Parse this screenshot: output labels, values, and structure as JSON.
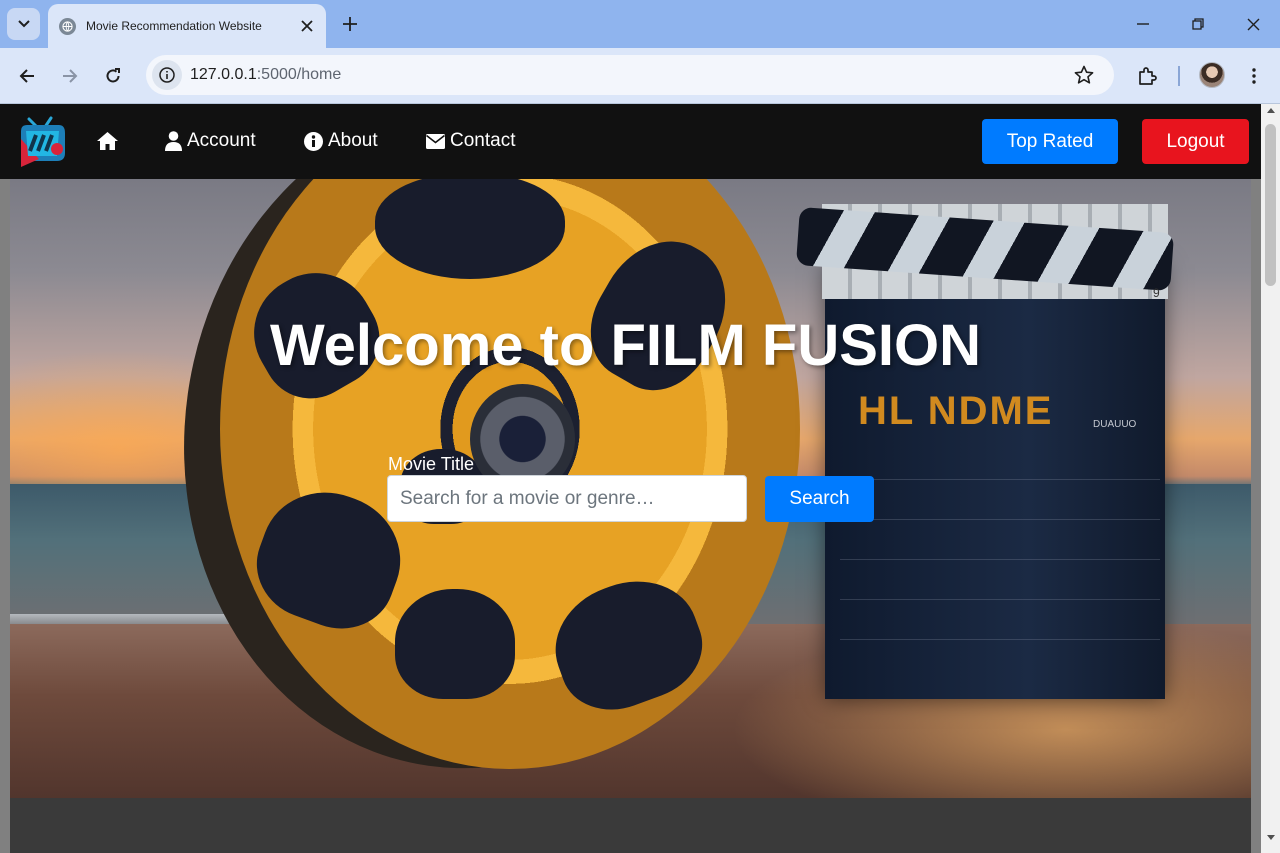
{
  "browser": {
    "tab_title": "Movie Recommendation Website",
    "url_host": "127.0.0.1",
    "url_path": ":5000/home"
  },
  "nav": {
    "account_label": "Account",
    "about_label": "About",
    "contact_label": "Contact",
    "top_rated_label": "Top Rated",
    "logout_label": "Logout"
  },
  "hero": {
    "title": "Welcome to FILM FUSION",
    "field_label": "Movie Title",
    "search_placeholder": "Search for a movie or genre…",
    "search_button": "Search",
    "clapper_text": "HL NDME",
    "clapper_small_text": "DUAUUO",
    "clapper_digit": "9"
  },
  "colors": {
    "nav_bg": "#111111",
    "primary": "#007bff",
    "danger": "#e8141e",
    "chrome_tabstrip": "#8fb4ee",
    "chrome_toolbar": "#dbe6f9"
  },
  "icons": [
    "tab-search-icon",
    "globe-icon",
    "close-icon",
    "plus-icon",
    "minimize-icon",
    "restore-icon",
    "window-close-icon",
    "back-icon",
    "forward-icon",
    "reload-icon",
    "info-icon",
    "star-icon",
    "extensions-icon",
    "kebab-menu-icon",
    "home-icon",
    "user-icon",
    "info-circle-icon",
    "envelope-icon"
  ]
}
